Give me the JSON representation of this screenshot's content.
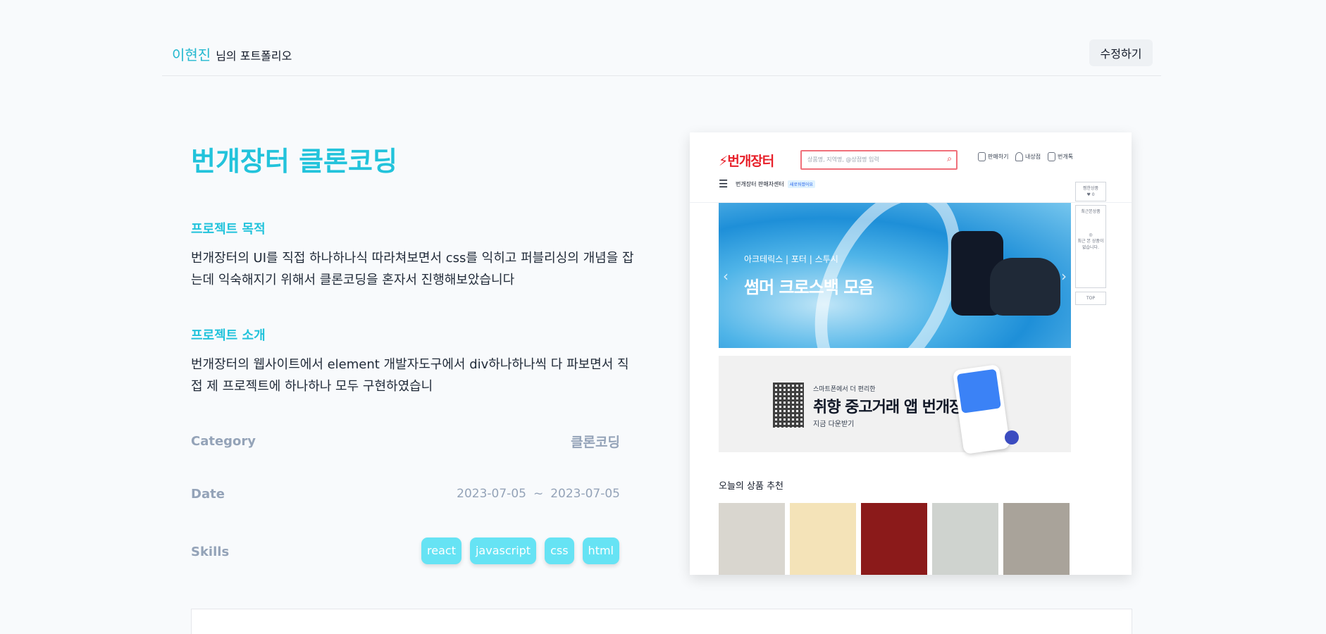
{
  "header": {
    "owner_name": "이현진",
    "owner_suffix": "님의 포트폴리오",
    "edit_label": "수정하기"
  },
  "project": {
    "title": "번개장터 클론코딩",
    "purpose_heading": "프로젝트 목적",
    "purpose_text": "번개장터의 UI를 직접 하나하나식 따라쳐보면서 css를 익히고 퍼블리싱의 개념을 잡는데 익숙해지기 위해서 클론코딩을 혼자서 진행해보았습니다",
    "intro_heading": "프로젝트 소개",
    "intro_text": "번개장터의 웹사이트에서 element 개발자도구에서 div하나하나씩 다 파보면서 직접 제 프로젝트에 하나하나 모두 구현하였습니",
    "category_label": "Category",
    "category_value": "클론코딩",
    "date_label": "Date",
    "date_start": "2023-07-05",
    "date_sep": "~",
    "date_end": "2023-07-05",
    "skills_label": "Skills",
    "skills": [
      "react",
      "javascript",
      "css",
      "html"
    ]
  },
  "preview": {
    "logo": "⚡번개장터",
    "search_placeholder": "상품명, 지역명, @상점명 입력",
    "menu_sell": "판매하기",
    "menu_shop": "내상점",
    "menu_talk": "번개톡",
    "center_label": "번개장터 판매자센터",
    "center_badge": "새로워졌어요",
    "banner_sub": "아크테릭스 | 포터 | 스투시",
    "banner_title": "썸머 크로스백 모음",
    "side_liked": "찜한상품",
    "side_liked_count": "♥ 0",
    "side_recent": "최근본상품",
    "side_empty": "최근 본 상품이 없습니다.",
    "side_top": "TOP",
    "app_small": "스마트폰에서 더 편리한",
    "app_title": "취향 중고거래 앱 번개장터",
    "app_link": "지금 다운받기",
    "recommend_title": "오늘의 상품 추천",
    "thumb_colors": [
      "#d9d6cf",
      "#f4e3b8",
      "#8b1a1a",
      "#cfd3cf",
      "#a9a39a"
    ]
  },
  "colors": {
    "accent": "#22c3db",
    "chip": "#66e3f4",
    "muted": "#94a3b8"
  }
}
